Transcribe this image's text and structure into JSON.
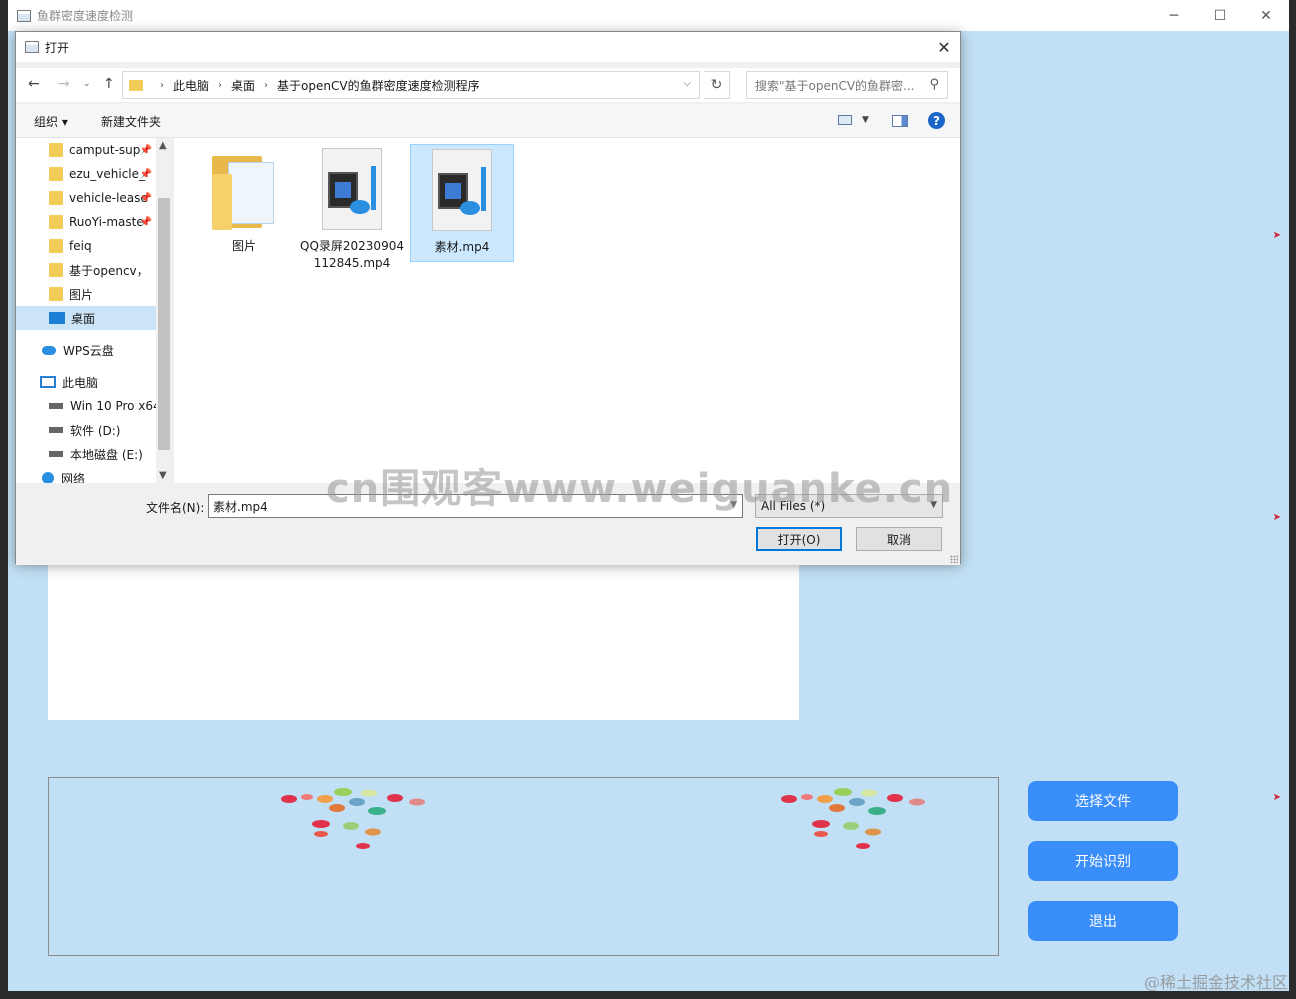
{
  "app": {
    "title": "鱼群密度速度检测",
    "win_min": "─",
    "win_max": "☐",
    "win_close": "✕",
    "buttons": {
      "select_file": "选择文件",
      "start": "开始识别",
      "exit": "退出"
    }
  },
  "dialog": {
    "title": "打开",
    "close": "✕",
    "nav": {
      "back": "←",
      "forward": "→",
      "dropdown": "⌄",
      "up": "↑",
      "refresh": "↻"
    },
    "breadcrumb": [
      "此电脑",
      "桌面",
      "基于openCV的鱼群密度速度检测程序"
    ],
    "breadcrumb_sep": "›",
    "search_placeholder": "搜索\"基于openCV的鱼群密...",
    "toolbar": {
      "organize": "组织 ▾",
      "new_folder": "新建文件夹",
      "help": "?"
    },
    "nav_items": [
      {
        "label": "camput-sup",
        "pinned": true
      },
      {
        "label": "ezu_vehicle_",
        "pinned": true
      },
      {
        "label": "vehicle-lease",
        "pinned": true
      },
      {
        "label": "RuoYi-maste",
        "pinned": true
      },
      {
        "label": "feiq",
        "pinned": false
      },
      {
        "label": "基于opencv，",
        "pinned": false
      },
      {
        "label": "图片",
        "pinned": false
      },
      {
        "label": "桌面",
        "pinned": false
      },
      {
        "label": "WPS云盘",
        "pinned": false
      },
      {
        "label": "此电脑",
        "pinned": false
      },
      {
        "label": "Win 10 Pro x64",
        "pinned": false
      },
      {
        "label": "软件 (D:)",
        "pinned": false
      },
      {
        "label": "本地磁盘 (E:)",
        "pinned": false
      },
      {
        "label": "网络",
        "pinned": false
      }
    ],
    "pin_glyph": "📌",
    "files": [
      {
        "name": "图片",
        "type": "folder"
      },
      {
        "name": "QQ录屏20230904112845.mp4",
        "type": "video"
      },
      {
        "name": "素材.mp4",
        "type": "video",
        "selected": true
      }
    ],
    "filename_label": "文件名(N):",
    "filename_value": "素材.mp4",
    "filetype_value": "All Files (*)",
    "open_button": "打开(O)",
    "cancel_button": "取消"
  },
  "watermark": "cn围观客www.weiguanke.cn",
  "credit": "@稀土掘金技术社区"
}
